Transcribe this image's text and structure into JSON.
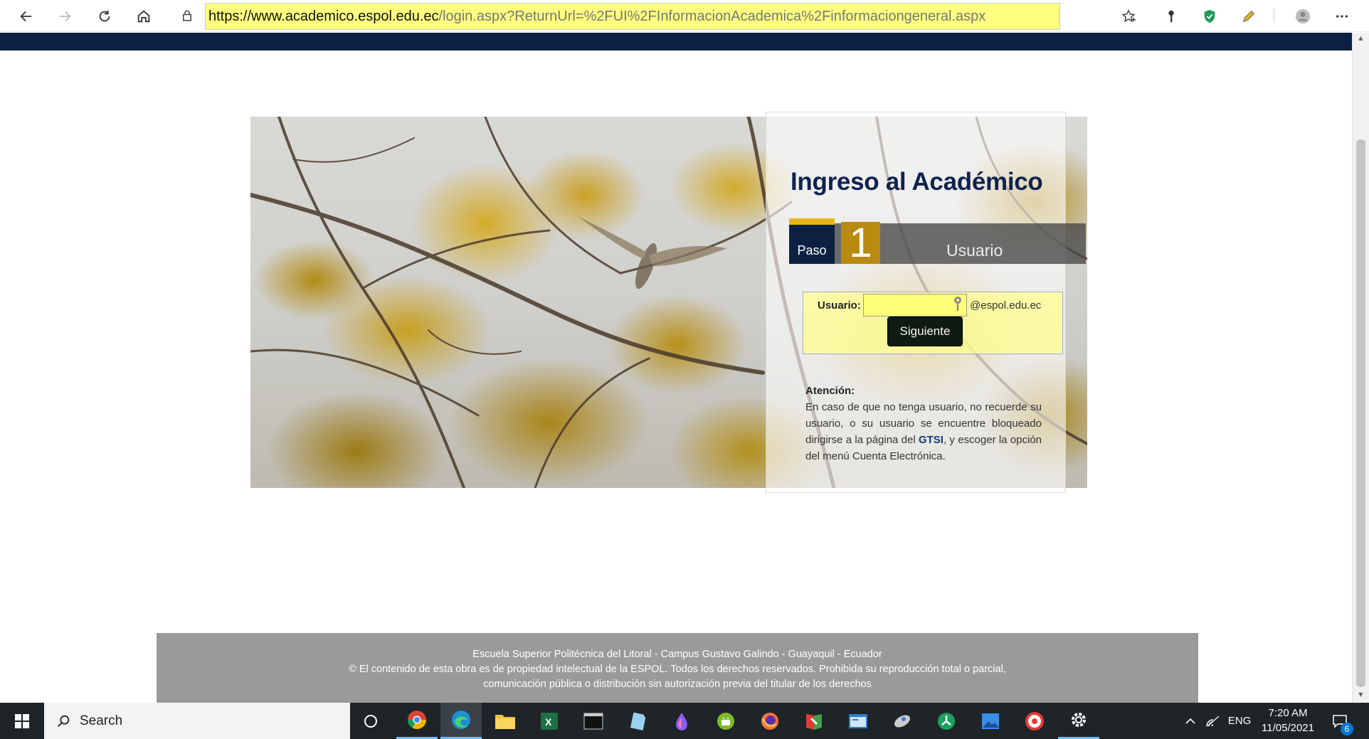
{
  "browser": {
    "url_host": "https://www.academico.espol.edu.ec",
    "url_path": "/login.aspx?ReturnUrl=%2FUI%2FInformacionAcademica%2Finformaciongeneral.aspx"
  },
  "login": {
    "title": "Ingreso al Académico",
    "step": {
      "prefix": "Paso",
      "number": "1",
      "label": "Usuario"
    },
    "user_label": "Usuario:",
    "user_value": "",
    "user_suffix": "@espol.edu.ec",
    "next_button": "Siguiente"
  },
  "notice": {
    "title": "Atención:",
    "text_before_link": "En caso de que no tenga usuario, no recuerde su usuario, o su usuario se encuentre bloqueado dirigirse a la página del ",
    "link_text": "GTSI",
    "text_after_link": ", y escoger la opción del menú Cuenta Electrónica."
  },
  "footer": {
    "line1": "Escuela Superior Politécnica del Litoral - Campus Gustavo Galindo - Guayaquil - Ecuador",
    "line2": "© El contenido de esta obra es de propiedad intelectual de la ESPOL. Todos los derechos reservados. Prohibida su reproducción total o parcial,",
    "line3": "comunicación pública o distribución sin autorización previa del titular de los derechos"
  },
  "taskbar": {
    "search_label": "Search",
    "language": "ENG",
    "time": "7:20 AM",
    "date": "11/05/2021",
    "notification_count": "6"
  },
  "colors": {
    "navy": "#0c2142",
    "accent_gold": "#b98a10",
    "url_highlight": "#ffff80",
    "footer_gray": "#9a9a9a"
  }
}
